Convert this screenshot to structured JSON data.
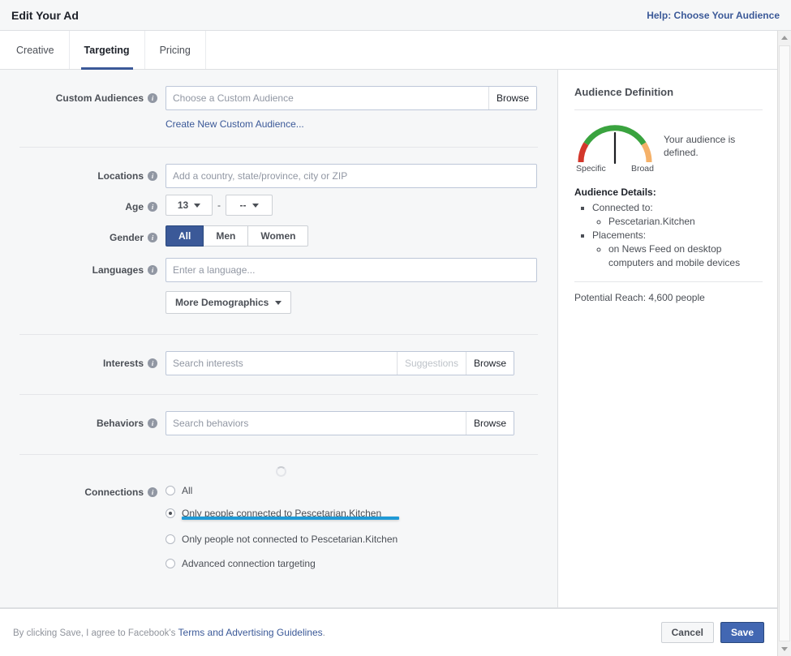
{
  "header": {
    "title": "Edit Your Ad",
    "help_link": "Help: Choose Your Audience"
  },
  "tabs": [
    {
      "label": "Creative",
      "active": false
    },
    {
      "label": "Targeting",
      "active": true
    },
    {
      "label": "Pricing",
      "active": false
    }
  ],
  "form": {
    "custom_audiences": {
      "label": "Custom Audiences",
      "placeholder": "Choose a Custom Audience",
      "value": "",
      "browse_label": "Browse",
      "create_link": "Create New Custom Audience..."
    },
    "locations": {
      "label": "Locations",
      "placeholder": "Add a country, state/province, city or ZIP",
      "value": ""
    },
    "age": {
      "label": "Age",
      "min_value": "13",
      "max_value": "--",
      "separator": "-"
    },
    "gender": {
      "label": "Gender",
      "options": [
        "All",
        "Men",
        "Women"
      ],
      "selected": "All"
    },
    "languages": {
      "label": "Languages",
      "placeholder": "Enter a language...",
      "value": ""
    },
    "more_demographics": {
      "label": "More Demographics"
    },
    "interests": {
      "label": "Interests",
      "placeholder": "Search interests",
      "value": "",
      "suggestions_label": "Suggestions",
      "browse_label": "Browse"
    },
    "behaviors": {
      "label": "Behaviors",
      "placeholder": "Search behaviors",
      "value": "",
      "browse_label": "Browse"
    },
    "connections": {
      "label": "Connections",
      "options": [
        {
          "label": "All",
          "selected": false,
          "highlighted": false
        },
        {
          "label": "Only people connected to Pescetarian.Kitchen",
          "selected": true,
          "highlighted": true
        },
        {
          "label": "Only people not connected to Pescetarian.Kitchen",
          "selected": false,
          "highlighted": false
        },
        {
          "label": "Advanced connection targeting",
          "selected": false,
          "highlighted": false
        }
      ]
    }
  },
  "sidebar": {
    "title": "Audience Definition",
    "gauge": {
      "left_label": "Specific",
      "right_label": "Broad",
      "message": "Your audience is defined.",
      "needle_angle_deg": 0,
      "colors": {
        "low": "#d3372b",
        "mid": "#3aa33f",
        "high": "#f5b169",
        "needle": "#1c1e21"
      }
    },
    "details_title": "Audience Details:",
    "details": [
      {
        "label": "Connected to:",
        "children": [
          "Pescetarian.Kitchen"
        ]
      },
      {
        "label": "Placements:",
        "children": [
          "on News Feed on desktop computers and mobile devices"
        ]
      }
    ],
    "reach": "Potential Reach: 4,600 people"
  },
  "footer": {
    "legal_prefix": "By clicking Save, I agree to Facebook's ",
    "legal_link": "Terms and Advertising Guidelines",
    "legal_suffix": ".",
    "cancel_label": "Cancel",
    "save_label": "Save"
  },
  "colors": {
    "brand": "#3b5998",
    "primary_button": "#4267b2",
    "highlight": "#1f9ad6",
    "page_bg": "#f6f7f8"
  }
}
